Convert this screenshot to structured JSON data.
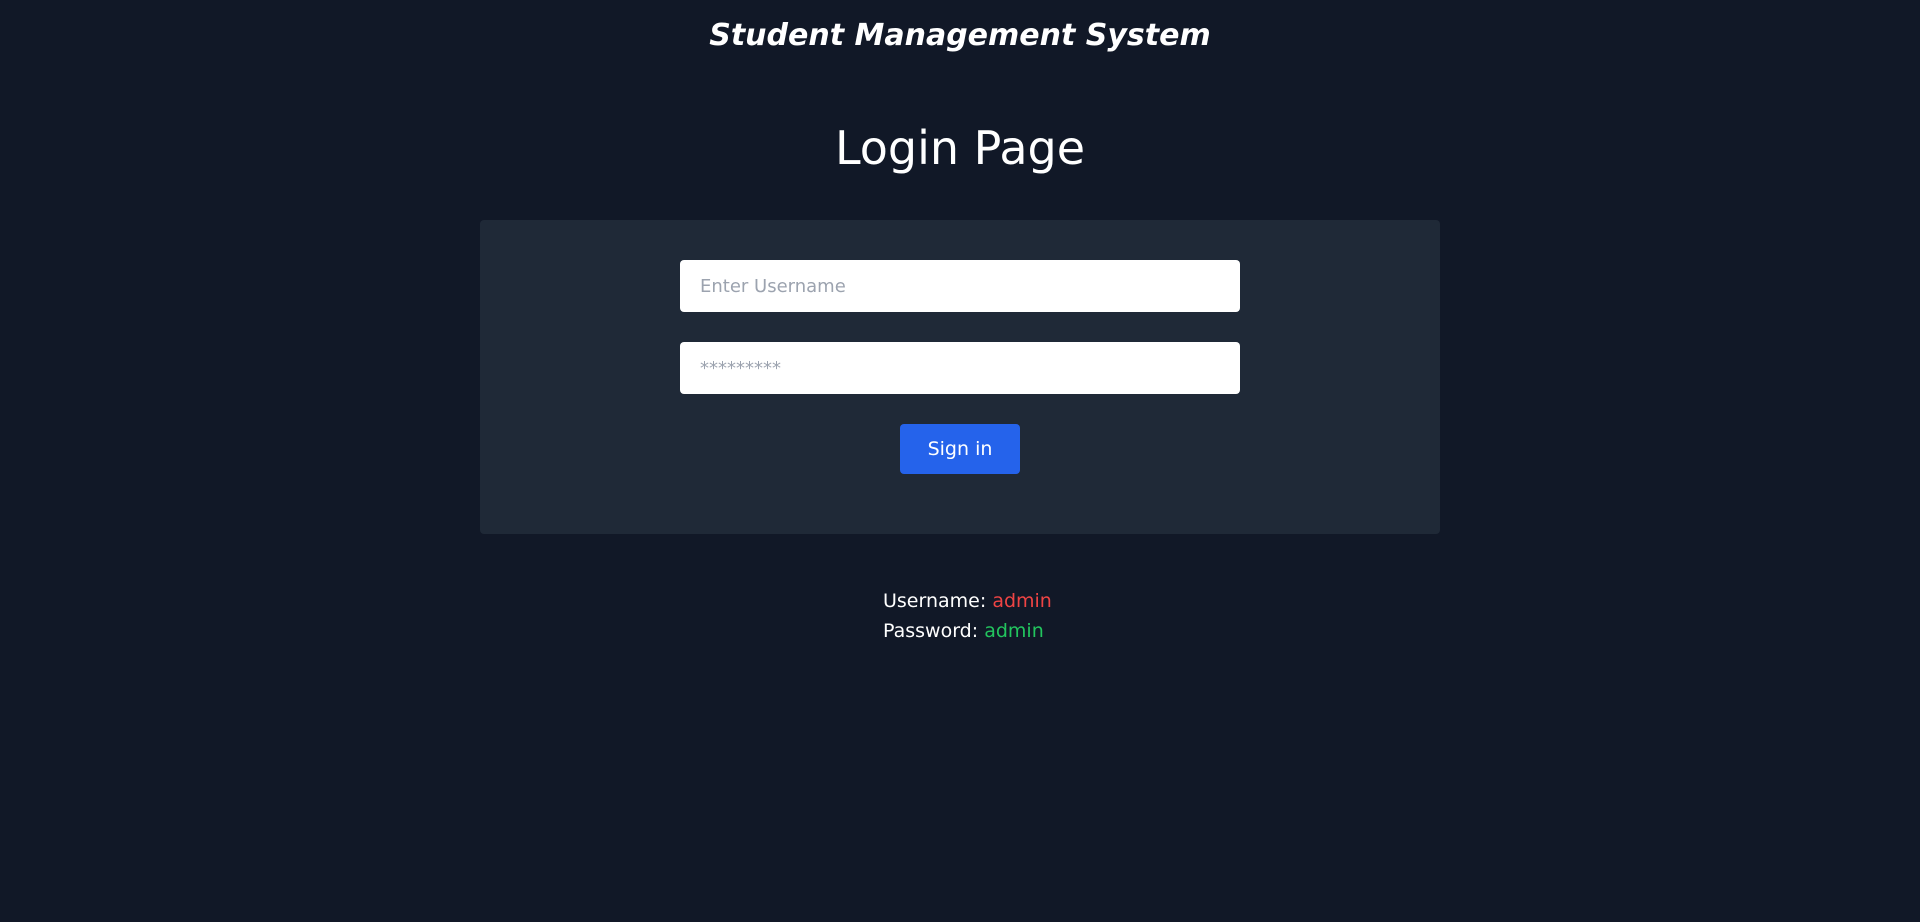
{
  "header": {
    "app_title": "Student Management System"
  },
  "main": {
    "page_title": "Login Page",
    "form": {
      "username": {
        "value": "",
        "placeholder": "Enter Username"
      },
      "password": {
        "value": "",
        "placeholder": "*********"
      },
      "submit_label": "Sign in"
    },
    "credentials": {
      "username_label": "Username:",
      "username_value": "admin",
      "password_label": "Password:",
      "password_value": "admin"
    }
  },
  "colors": {
    "background": "#111827",
    "card": "#1f2937",
    "button": "#2563eb",
    "username_value": "#ef4444",
    "password_value": "#22c55e"
  }
}
